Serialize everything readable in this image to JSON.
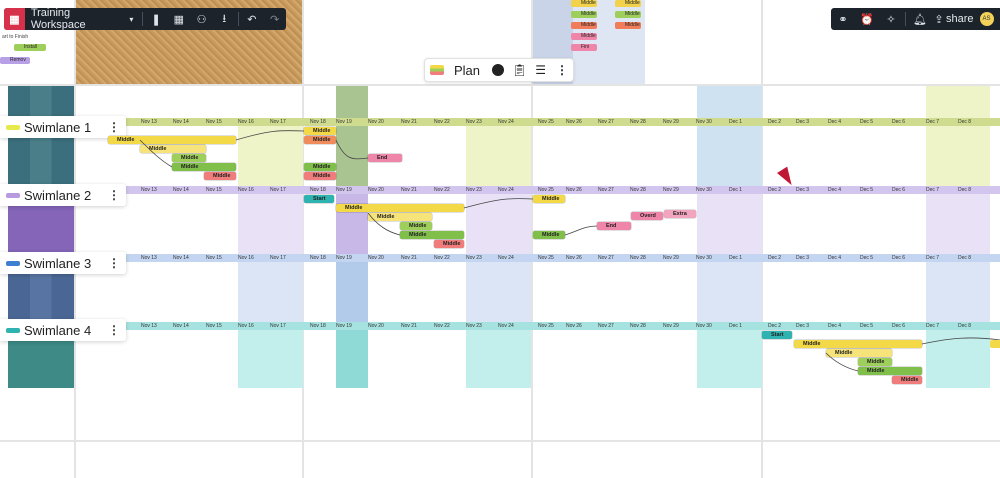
{
  "app": {
    "workspace_name": "Training Workspace",
    "share_label": "share",
    "avatar_initials": "AS"
  },
  "plan_bar": {
    "title": "Plan"
  },
  "top_strip": {
    "cork_note_title": "art to Finish",
    "cork_items": [
      "Install",
      "Remov"
    ],
    "top_board_items": [
      "Middle",
      "Middle",
      "Middle",
      "Middle",
      "Middle",
      "Middle",
      "Middle",
      "Fini"
    ]
  },
  "dates": {
    "group1": [
      "Nov 13",
      "Nov 14",
      "Nov 15",
      "Nov 16",
      "Nov 17"
    ],
    "group2": [
      "Nov 18",
      "Nov 19",
      "Nov 20",
      "Nov 21",
      "Nov 22",
      "Nov 23",
      "Nov 24"
    ],
    "group3": [
      "Nov 25",
      "Nov 26",
      "Nov 27",
      "Nov 28",
      "Nov 29",
      "Nov 30",
      "Dec 1"
    ],
    "group4": [
      "Dec 2",
      "Dec 3",
      "Dec 4",
      "Dec 5",
      "Dec 6",
      "Dec 7",
      "Dec 8"
    ]
  },
  "swimlanes": [
    {
      "title": "Swimlane 1",
      "color": "#e6ea4a",
      "tasks": [
        "Middle",
        "Middle",
        "Middle",
        "Middle",
        "Middle",
        "Middle",
        "Middle",
        "Middle",
        "Middle",
        "End"
      ]
    },
    {
      "title": "Swimlane 2",
      "color": "#b89ae0",
      "tasks": [
        "Start",
        "Middle",
        "Middle",
        "Middle",
        "Middle",
        "Middle",
        "Middle",
        "Middle",
        "End",
        "Overd",
        "Extra"
      ]
    },
    {
      "title": "Swimlane 3",
      "color": "#3f7fd1",
      "tasks": []
    },
    {
      "title": "Swimlane 4",
      "color": "#2fb3b0",
      "tasks": [
        "Start",
        "Middle",
        "Middle",
        "Middle",
        "Middle",
        "Middle"
      ]
    }
  ],
  "colors": {
    "lane1_band": "#c8d98b",
    "lane2_band": "#cbbde8",
    "lane3_band": "#b9cdef",
    "lane4_band": "#8fd9d6",
    "toolbar_bg": "#1d232b"
  }
}
